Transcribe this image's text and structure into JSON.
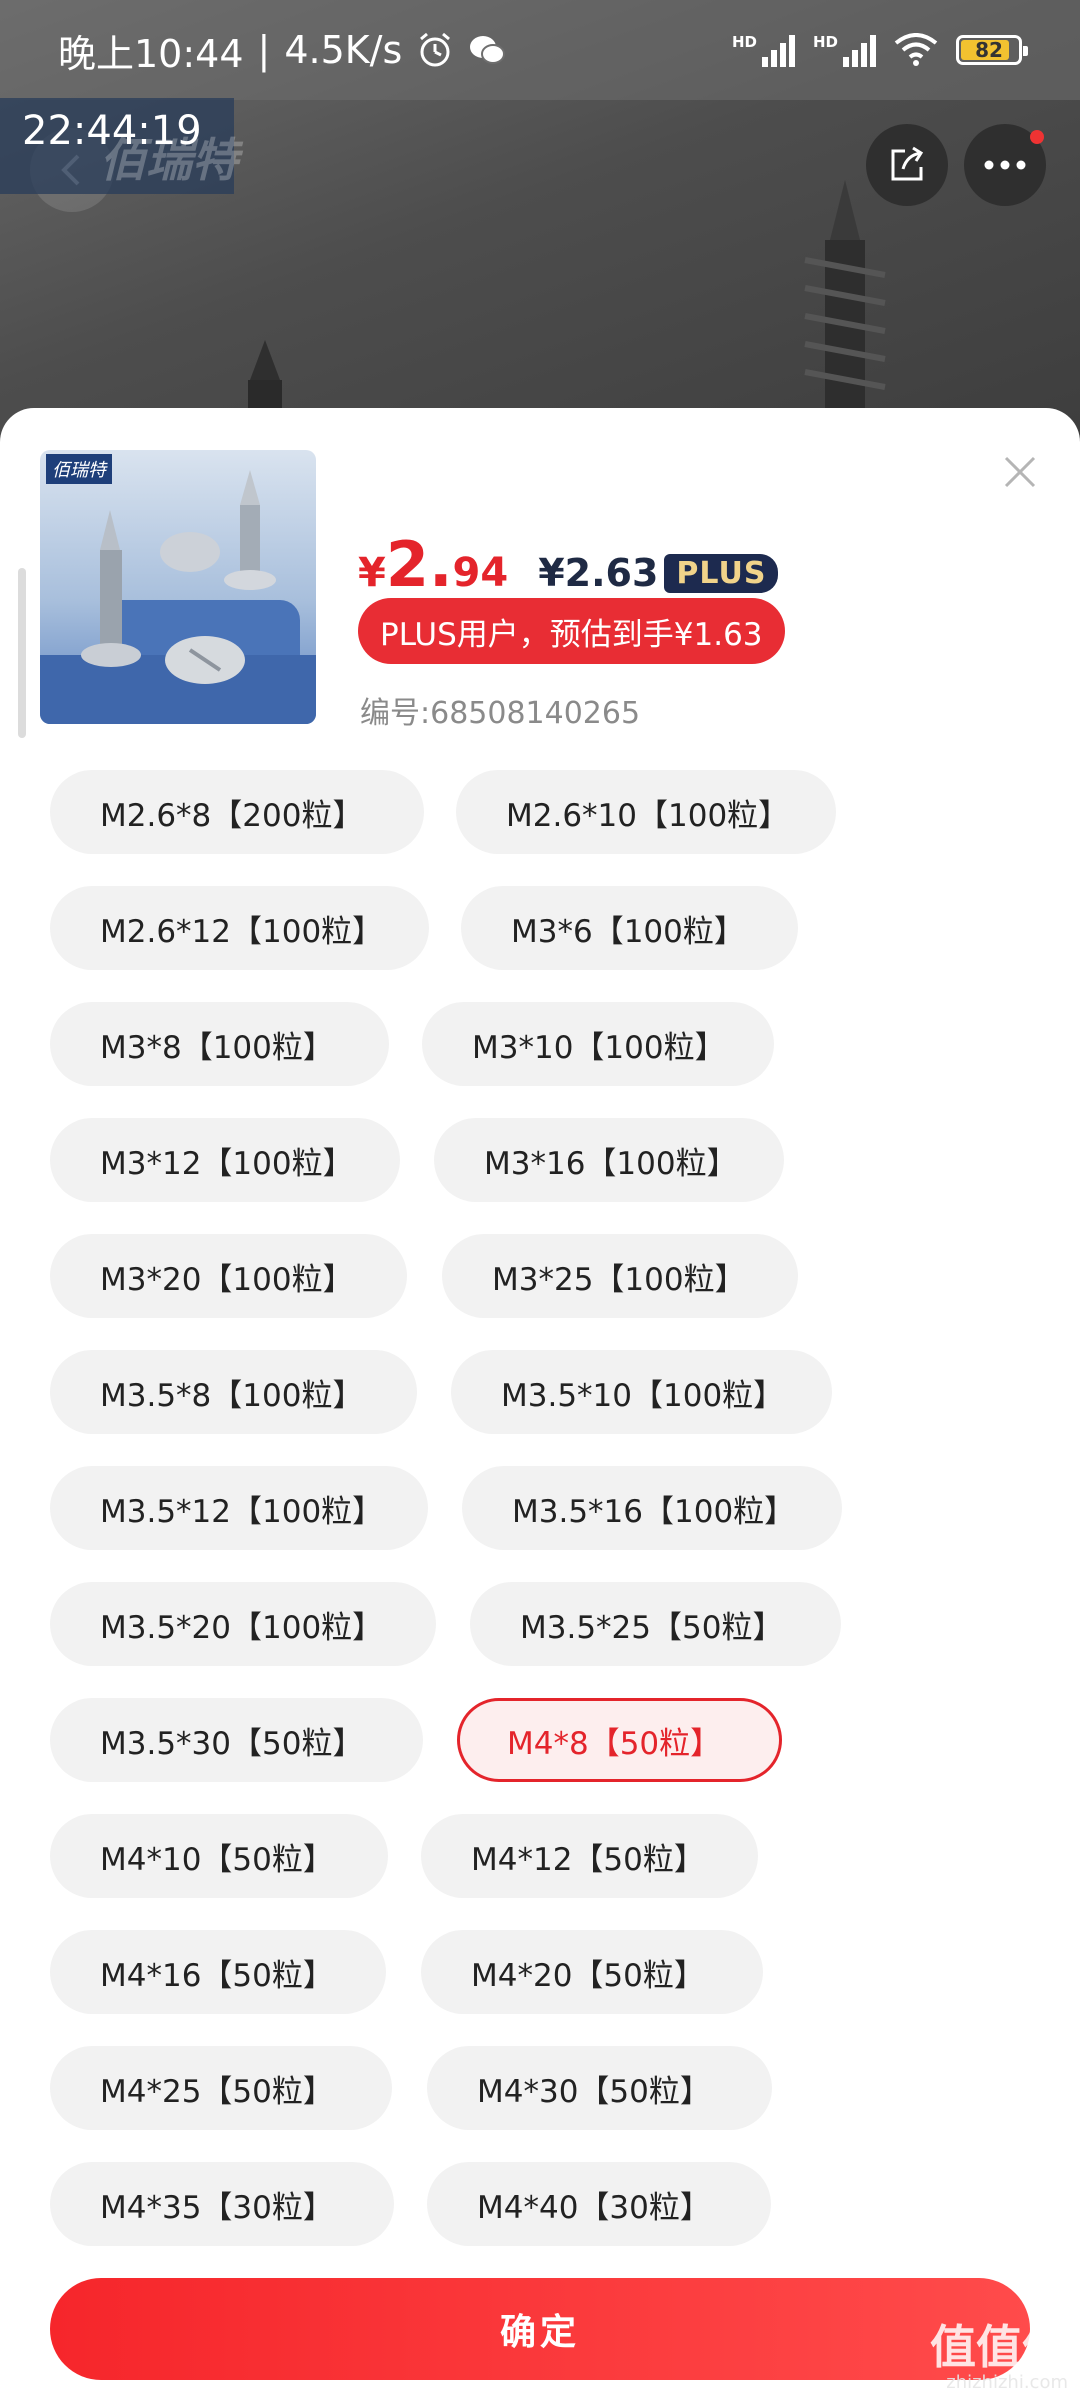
{
  "status_bar": {
    "time": "晚上10:44",
    "net_speed": "4.5K/s",
    "separator": "|",
    "hd_label": "HD",
    "battery": "82"
  },
  "overlay": {
    "timestamp": "22:44:19",
    "brand_ghost": "佰瑞特"
  },
  "product": {
    "thumb_logo": "佰瑞特",
    "price_symbol": "¥",
    "price_int": "2.",
    "price_dec": "94",
    "plus_price": "¥2.63",
    "plus_tag": "PLUS",
    "plus_estimate": "PLUS用户，预估到手¥1.63",
    "sku_code": "编号:68508140265"
  },
  "options": [
    {
      "label": "M2.6*8【200粒】",
      "selected": false
    },
    {
      "label": "M2.6*10【100粒】",
      "selected": false
    },
    {
      "label": "M2.6*12【100粒】",
      "selected": false
    },
    {
      "label": "M3*6【100粒】",
      "selected": false
    },
    {
      "label": "M3*8【100粒】",
      "selected": false
    },
    {
      "label": "M3*10【100粒】",
      "selected": false
    },
    {
      "label": "M3*12【100粒】",
      "selected": false
    },
    {
      "label": "M3*16【100粒】",
      "selected": false
    },
    {
      "label": "M3*20【100粒】",
      "selected": false
    },
    {
      "label": "M3*25【100粒】",
      "selected": false
    },
    {
      "label": "M3.5*8【100粒】",
      "selected": false
    },
    {
      "label": "M3.5*10【100粒】",
      "selected": false
    },
    {
      "label": "M3.5*12【100粒】",
      "selected": false
    },
    {
      "label": "M3.5*16【100粒】",
      "selected": false
    },
    {
      "label": "M3.5*20【100粒】",
      "selected": false
    },
    {
      "label": "M3.5*25【50粒】",
      "selected": false
    },
    {
      "label": "M3.5*30【50粒】",
      "selected": false
    },
    {
      "label": "M4*8【50粒】",
      "selected": true
    },
    {
      "label": "M4*10【50粒】",
      "selected": false
    },
    {
      "label": "M4*12【50粒】",
      "selected": false
    },
    {
      "label": "M4*16【50粒】",
      "selected": false
    },
    {
      "label": "M4*20【50粒】",
      "selected": false
    },
    {
      "label": "M4*25【50粒】",
      "selected": false
    },
    {
      "label": "M4*30【50粒】",
      "selected": false
    },
    {
      "label": "M4*35【30粒】",
      "selected": false
    },
    {
      "label": "M4*40【30粒】",
      "selected": false
    }
  ],
  "confirm_label": "确定",
  "watermark": {
    "main": "值值值",
    "sub": "zhizhizhi.com"
  },
  "colors": {
    "accent": "#e4242b",
    "plus_tag_bg": "#1d2a4f",
    "plus_tag_text": "#f1d38a"
  }
}
